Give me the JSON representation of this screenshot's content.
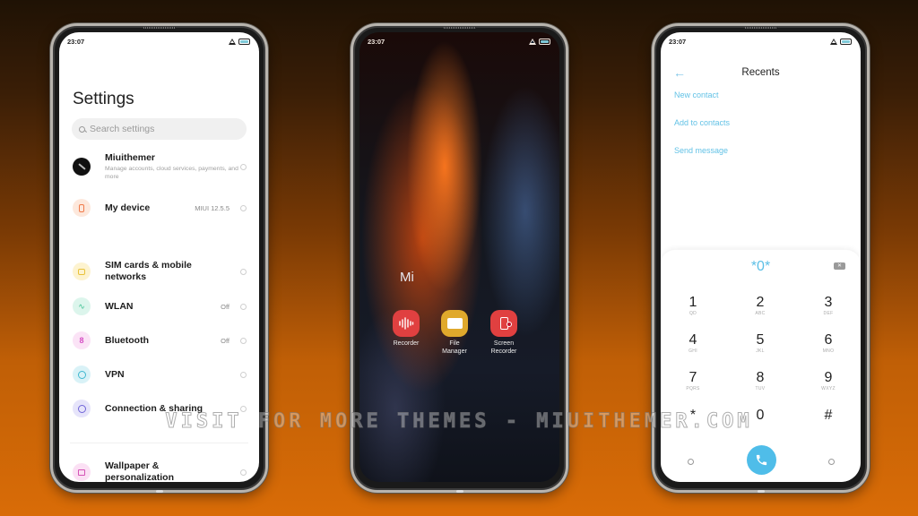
{
  "status_bar": {
    "time": "23:07",
    "icons": [
      "signal-icon",
      "battery-icon"
    ]
  },
  "settings_screen": {
    "title": "Settings",
    "search_placeholder": "Search settings",
    "items": [
      {
        "icon": "avatar-icon",
        "label": "Miuithemer",
        "sub": "Manage accounts, cloud services, payments, and more",
        "value": ""
      },
      {
        "icon": "device-icon",
        "label": "My device",
        "sub": "",
        "value": "MIUI 12.5.5"
      },
      {
        "icon": "sim-icon",
        "label": "SIM cards & mobile networks",
        "sub": "",
        "value": ""
      },
      {
        "icon": "wifi-icon",
        "label": "WLAN",
        "sub": "",
        "value": "Off"
      },
      {
        "icon": "bluetooth-icon",
        "label": "Bluetooth",
        "sub": "",
        "value": "Off"
      },
      {
        "icon": "vpn-icon",
        "label": "VPN",
        "sub": "",
        "value": ""
      },
      {
        "icon": "connection-icon",
        "label": "Connection & sharing",
        "sub": "",
        "value": ""
      },
      {
        "icon": "wallpaper-icon",
        "label": "Wallpaper & personalization",
        "sub": "",
        "value": ""
      }
    ]
  },
  "home_screen": {
    "folder_label": "Mi",
    "apps": [
      {
        "icon": "recorder-icon",
        "label": "Recorder",
        "color": "#e04040"
      },
      {
        "icon": "folder-icon",
        "label": "File Manager",
        "color": "#e0a92c"
      },
      {
        "icon": "screen-recorder-icon",
        "label": "Screen Recorder",
        "color": "#e04040"
      }
    ]
  },
  "dialer_screen": {
    "title": "Recents",
    "links": [
      "New contact",
      "Add to contacts",
      "Send message"
    ],
    "entry": "*0*",
    "keys": [
      {
        "num": "1",
        "sub": "QD"
      },
      {
        "num": "2",
        "sub": "ABC"
      },
      {
        "num": "3",
        "sub": "DEF"
      },
      {
        "num": "4",
        "sub": "GHI"
      },
      {
        "num": "5",
        "sub": "JKL"
      },
      {
        "num": "6",
        "sub": "MNO"
      },
      {
        "num": "7",
        "sub": "PQRS"
      },
      {
        "num": "8",
        "sub": "TUV"
      },
      {
        "num": "9",
        "sub": "WXYZ"
      },
      {
        "num": "*",
        "sub": ""
      },
      {
        "num": "0",
        "sub": ""
      },
      {
        "num": "#",
        "sub": ""
      }
    ],
    "accent": "#4fbde9"
  },
  "watermark": "VISIT FOR MORE THEMES - MIUITHEMER.COM"
}
